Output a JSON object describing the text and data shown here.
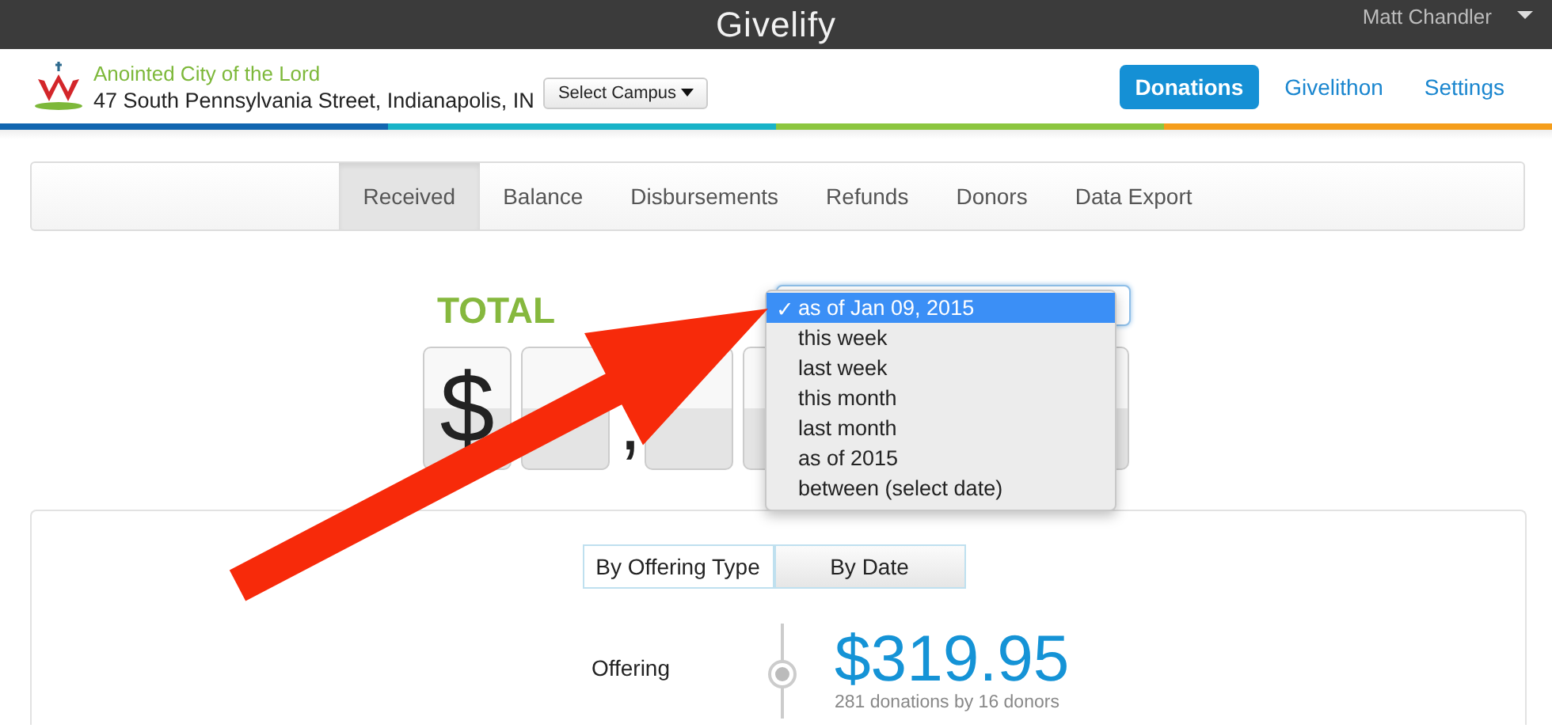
{
  "top_bar": {
    "brand": "Givelify",
    "user": "Matt Chandler"
  },
  "header": {
    "org_name": "Anointed City of the Lord",
    "address": "47 South Pennsylvania Street, Indianapolis, IN",
    "campus_button": "Select Campus"
  },
  "nav": [
    {
      "label": "Donations",
      "selected": true
    },
    {
      "label": "Givelithon",
      "selected": false
    },
    {
      "label": "Settings",
      "selected": false
    }
  ],
  "sub_tabs": [
    {
      "label": "Received",
      "selected": true
    },
    {
      "label": "Balance",
      "selected": false
    },
    {
      "label": "Disbursements",
      "selected": false
    },
    {
      "label": "Refunds",
      "selected": false
    },
    {
      "label": "Donors",
      "selected": false
    },
    {
      "label": "Data Export",
      "selected": false
    }
  ],
  "total": {
    "title": "TOTAL",
    "digits": [
      {
        "kind": "tile",
        "text": "$"
      },
      {
        "kind": "tile"
      },
      {
        "kind": "separator",
        "text": ","
      },
      {
        "kind": "tile"
      },
      {
        "kind": "tile"
      }
    ]
  },
  "period_menu": {
    "check_mark": "✓",
    "options": [
      {
        "label": "as of Jan 09, 2015",
        "selected": true
      },
      {
        "label": "this week",
        "selected": false
      },
      {
        "label": "last week",
        "selected": false
      },
      {
        "label": "this month",
        "selected": false
      },
      {
        "label": "last month",
        "selected": false
      },
      {
        "label": "as of 2015",
        "selected": false
      },
      {
        "label": "between (select date)",
        "selected": false
      }
    ]
  },
  "breakdown": {
    "view_toggle": [
      {
        "label": "By Offering Type",
        "selected": true
      },
      {
        "label": "By Date",
        "selected": false
      }
    ],
    "rows": [
      {
        "label": "Offering",
        "amount": "$319.95",
        "detail": "281 donations by 16 donors"
      }
    ]
  }
}
